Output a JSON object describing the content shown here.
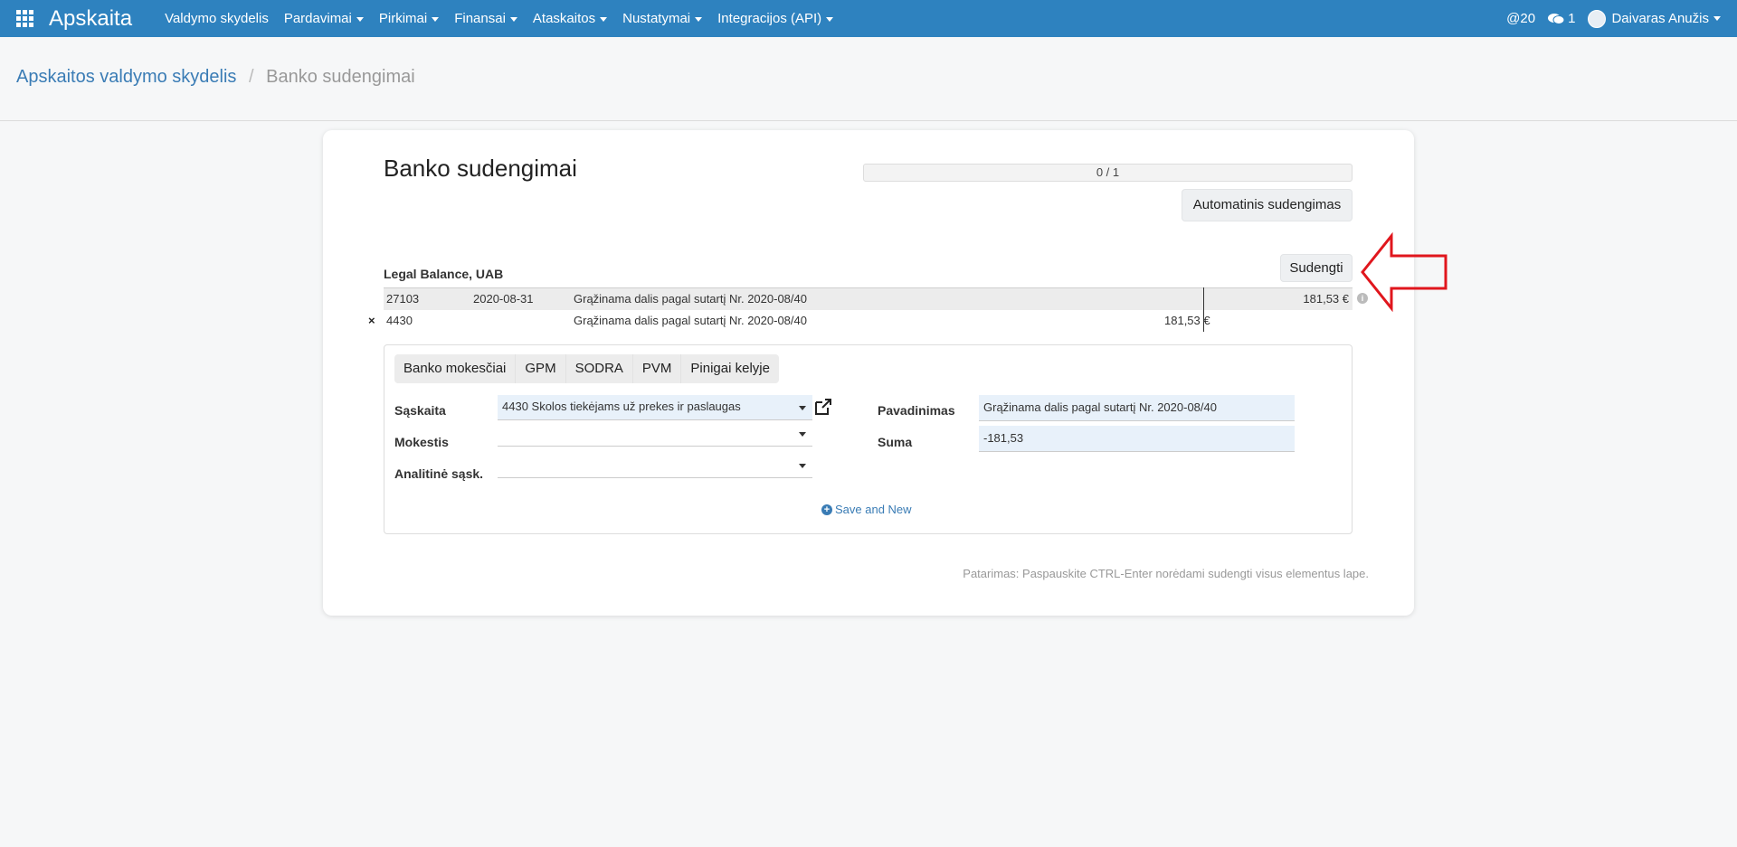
{
  "header": {
    "brand": "Apskaita",
    "nav": [
      {
        "label": "Valdymo skydelis",
        "dropdown": false
      },
      {
        "label": "Pardavimai",
        "dropdown": true
      },
      {
        "label": "Pirkimai",
        "dropdown": true
      },
      {
        "label": "Finansai",
        "dropdown": true
      },
      {
        "label": "Ataskaitos",
        "dropdown": true
      },
      {
        "label": "Nustatymai",
        "dropdown": true
      },
      {
        "label": "Integracijos (API)",
        "dropdown": true
      }
    ],
    "mentions": "@20",
    "messages": "1",
    "user": "Daivaras Anužis",
    "colors": {
      "bar": "#2e82bf"
    }
  },
  "breadcrumb": {
    "parent": "Apskaitos valdymo skydelis",
    "separator": "/",
    "current": "Banko sudengimai"
  },
  "main": {
    "title": "Banko sudengimai",
    "progress_text": "0 / 1",
    "auto_button": "Automatinis sudengimas",
    "sudengti_button": "Sudengti",
    "partner": "Legal Balance, UAB",
    "bank_row": {
      "code": "27103",
      "date": "2020-08-31",
      "description": "Grąžinama dalis pagal sutartį Nr. 2020-08/40",
      "amount": "181,53 €"
    },
    "match_row": {
      "remove_icon": "×",
      "account": "4430",
      "description": "Grąžinama dalis pagal sutartį Nr. 2020-08/40",
      "amount": "181,53 €"
    },
    "form": {
      "tabs": [
        "Banko mokesčiai",
        "GPM",
        "SODRA",
        "PVM",
        "Pinigai kelyje"
      ],
      "labels": {
        "account": "Sąskaita",
        "tax": "Mokestis",
        "analytic": "Analitinė sąsk.",
        "name": "Pavadinimas",
        "sum": "Suma"
      },
      "values": {
        "account": "4430 Skolos tiekėjams už prekes ir paslaugas",
        "tax": "",
        "analytic": "",
        "name": "Grąžinama dalis pagal sutartį Nr. 2020-08/40",
        "sum": "-181,53"
      },
      "save_new": "Save and New"
    },
    "hint": "Patarimas: Paspauskite CTRL-Enter norėdami sudengti visus elementus lape."
  },
  "icons": [
    "apps-grid-icon",
    "at-icon",
    "chat-icon",
    "avatar-icon",
    "external-link-icon",
    "plus-circle-icon",
    "info-icon",
    "arrow-left-annotation-icon"
  ],
  "annotation_color": "#e0161d"
}
